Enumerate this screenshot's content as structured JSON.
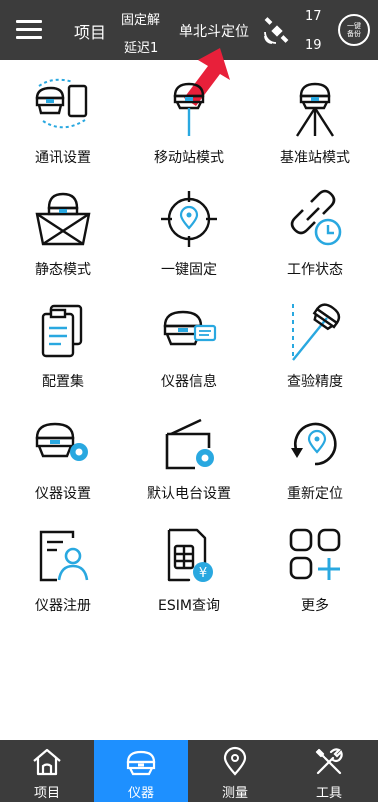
{
  "header": {
    "project": "项目",
    "fix_status": "固定解",
    "delay": "延迟1",
    "positioning_mode": "单北斗定位",
    "sat_count_1": "17",
    "sat_count_2": "19",
    "backup_line1": "一键",
    "backup_line2": "备份"
  },
  "grid": [
    {
      "label": "通讯设置",
      "icon": "communication-settings-icon"
    },
    {
      "label": "移动站模式",
      "icon": "rover-mode-icon"
    },
    {
      "label": "基准站模式",
      "icon": "base-station-mode-icon"
    },
    {
      "label": "静态模式",
      "icon": "static-mode-icon"
    },
    {
      "label": "一键固定",
      "icon": "one-key-fix-icon"
    },
    {
      "label": "工作状态",
      "icon": "work-status-icon"
    },
    {
      "label": "配置集",
      "icon": "config-set-icon"
    },
    {
      "label": "仪器信息",
      "icon": "instrument-info-icon"
    },
    {
      "label": "查验精度",
      "icon": "check-accuracy-icon"
    },
    {
      "label": "仪器设置",
      "icon": "instrument-settings-icon"
    },
    {
      "label": "默认电台设置",
      "icon": "default-radio-settings-icon"
    },
    {
      "label": "重新定位",
      "icon": "relocate-icon"
    },
    {
      "label": "仪器注册",
      "icon": "instrument-register-icon"
    },
    {
      "label": "ESIM查询",
      "icon": "esim-query-icon"
    },
    {
      "label": "更多",
      "icon": "more-icon"
    }
  ],
  "nav": [
    {
      "label": "项目",
      "icon": "home-icon",
      "active": false
    },
    {
      "label": "仪器",
      "icon": "instrument-icon",
      "active": true
    },
    {
      "label": "测量",
      "icon": "location-pin-icon",
      "active": false
    },
    {
      "label": "工具",
      "icon": "tools-icon",
      "active": false
    }
  ],
  "colors": {
    "header_bg": "#3c3c3c",
    "accent": "#1e90ff",
    "highlight": "#29a8e0",
    "arrow": "#e8203a"
  }
}
